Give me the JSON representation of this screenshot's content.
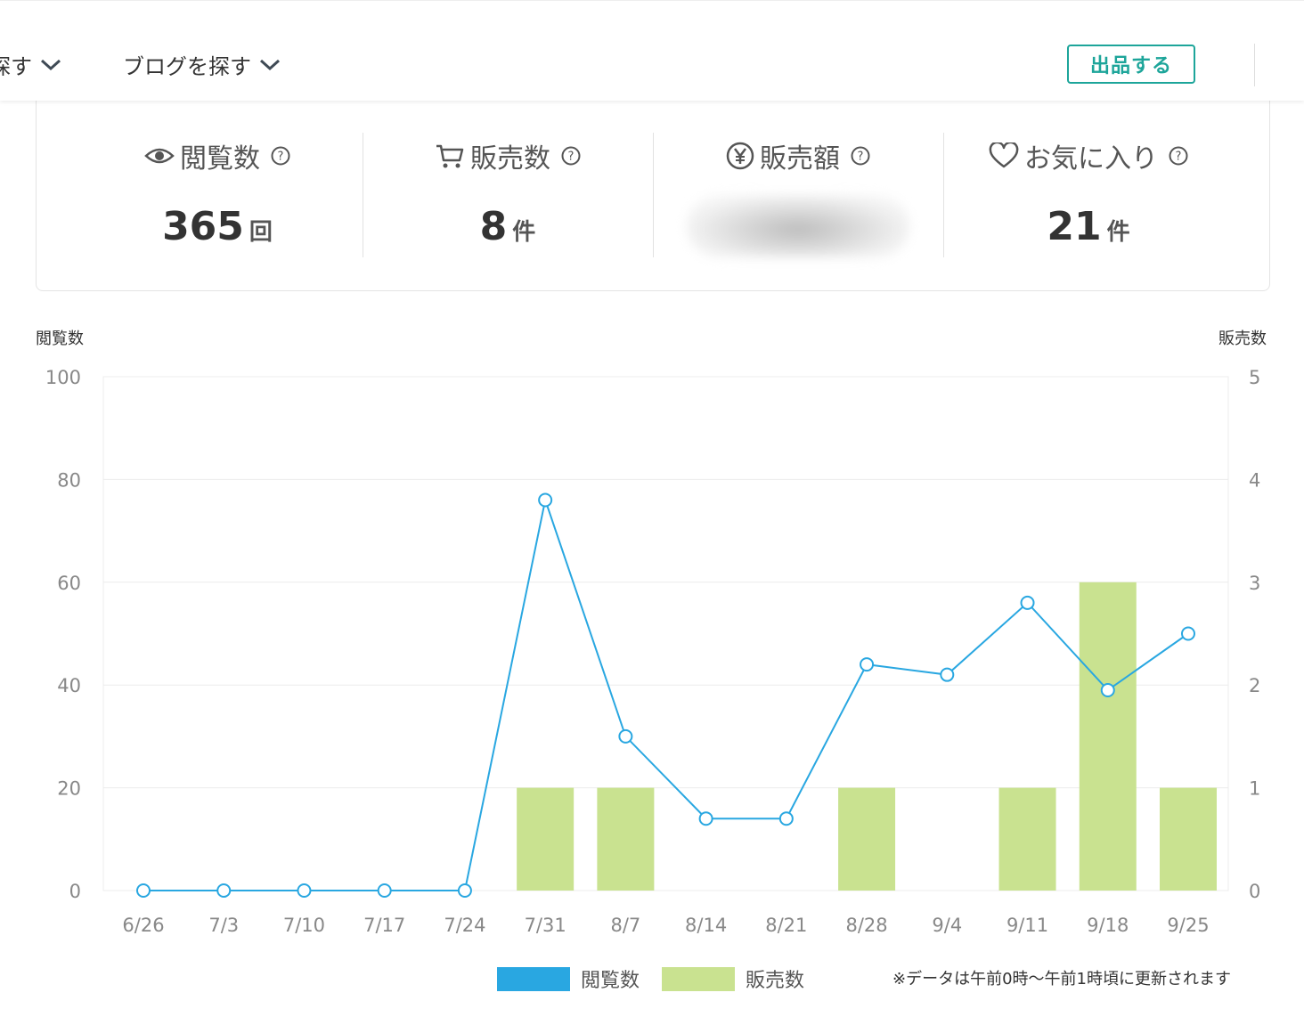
{
  "nav": {
    "items": [
      {
        "label": "探す"
      },
      {
        "label": "ブログを探す"
      }
    ],
    "sell_button": "出品する"
  },
  "stats": [
    {
      "icon": "eye-icon",
      "label": "閲覧数",
      "value": "365",
      "unit": "回"
    },
    {
      "icon": "cart-icon",
      "label": "販売数",
      "value": "8",
      "unit": "件"
    },
    {
      "icon": "yen-icon",
      "label": "販売額",
      "value": "",
      "unit": "",
      "redacted": true
    },
    {
      "icon": "heart-icon",
      "label": "お気に入り",
      "value": "21",
      "unit": "件"
    }
  ],
  "colors": {
    "views": "#29a7e1",
    "sales": "#c9e290",
    "accent": "#1da59a"
  },
  "chart_data": {
    "type": "bar",
    "categories": [
      "6/26",
      "7/3",
      "7/10",
      "7/17",
      "7/24",
      "7/31",
      "8/7",
      "8/14",
      "8/21",
      "8/28",
      "9/4",
      "9/11",
      "9/18",
      "9/25"
    ],
    "series": [
      {
        "name": "閲覧数",
        "type": "line",
        "axis": "left",
        "values": [
          0,
          0,
          0,
          0,
          0,
          76,
          30,
          14,
          14,
          44,
          42,
          56,
          39,
          50
        ]
      },
      {
        "name": "販売数",
        "type": "bar",
        "axis": "right",
        "values": [
          0,
          0,
          0,
          0,
          0,
          1,
          1,
          0,
          0,
          1,
          0,
          1,
          3,
          1
        ]
      }
    ],
    "ylabel_left": "閲覧数",
    "ylabel_right": "販売数",
    "ylim_left": [
      0,
      100
    ],
    "ylim_right": [
      0,
      5
    ],
    "yticks_left": [
      "0",
      "20",
      "40",
      "60",
      "80",
      "100"
    ],
    "yticks_right": [
      "0",
      "1",
      "2",
      "3",
      "4",
      "5"
    ],
    "grid": true,
    "legend": "bottom-center",
    "note": "※データは午前0時〜午前1時頃に更新されます"
  }
}
